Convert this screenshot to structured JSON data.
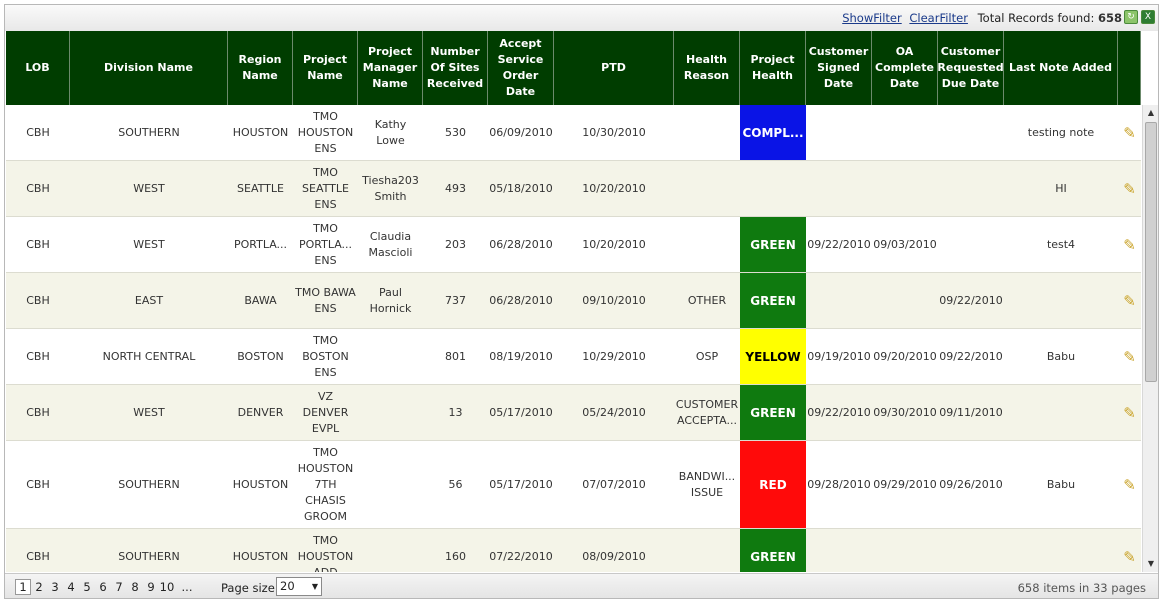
{
  "toolbar": {
    "show_filter": "ShowFilter",
    "clear_filter": "ClearFilter",
    "total_label": "Total Records found:",
    "total_count": "658",
    "refresh_icon": "refresh-icon",
    "excel_icon": "excel-export-icon"
  },
  "columns": [
    "LOB",
    "Division Name",
    "Region Name",
    "Project Name",
    "Project Manager Name",
    "Number Of Sites Received",
    "Accept Service Order Date",
    "PTD",
    "Health Reason",
    "Project Health",
    "Customer Signed Date",
    "OA Complete Date",
    "Customer Requested Due Date",
    "Last Note Added",
    ""
  ],
  "rows": [
    {
      "lob": "CBH",
      "division": "SOUTHERN",
      "region": "HOUSTON",
      "project": "TMO HOUSTON ENS",
      "manager": "Kathy Lowe",
      "sites": "530",
      "accept": "06/09/2010",
      "ptd": "10/30/2010",
      "reason": "",
      "health": "COMPL...",
      "health_color": "#0a14e6",
      "signed": "",
      "oa": "",
      "due": "",
      "note": "testing note"
    },
    {
      "lob": "CBH",
      "division": "WEST",
      "region": "SEATTLE",
      "project": "TMO SEATTLE ENS",
      "manager": "Tiesha203 Smith",
      "sites": "493",
      "accept": "05/18/2010",
      "ptd": "10/20/2010",
      "reason": "",
      "health": "",
      "health_color": "",
      "signed": "",
      "oa": "",
      "due": "",
      "note": "HI"
    },
    {
      "lob": "CBH",
      "division": "WEST",
      "region": "PORTLA...",
      "project": "TMO PORTLA... ENS",
      "manager": "Claudia Mascioli",
      "sites": "203",
      "accept": "06/28/2010",
      "ptd": "10/20/2010",
      "reason": "",
      "health": "GREEN",
      "health_color": "#0f7a0f",
      "signed": "09/22/2010",
      "oa": "09/03/2010",
      "due": "",
      "note": "test4"
    },
    {
      "lob": "CBH",
      "division": "EAST",
      "region": "BAWA",
      "project": "TMO BAWA ENS",
      "manager": "Paul Hornick",
      "sites": "737",
      "accept": "06/28/2010",
      "ptd": "09/10/2010",
      "reason": "OTHER",
      "health": "GREEN",
      "health_color": "#0f7a0f",
      "signed": "",
      "oa": "",
      "due": "09/22/2010",
      "note": ""
    },
    {
      "lob": "CBH",
      "division": "NORTH CENTRAL",
      "region": "BOSTON",
      "project": "TMO BOSTON ENS",
      "manager": "",
      "sites": "801",
      "accept": "08/19/2010",
      "ptd": "10/29/2010",
      "reason": "OSP",
      "health": "YELLOW",
      "health_color": "#ffff00",
      "signed": "09/19/2010",
      "oa": "09/20/2010",
      "due": "09/22/2010",
      "note": "Babu"
    },
    {
      "lob": "CBH",
      "division": "WEST",
      "region": "DENVER",
      "project": "VZ DENVER EVPL",
      "manager": "",
      "sites": "13",
      "accept": "05/17/2010",
      "ptd": "05/24/2010",
      "reason": "CUSTOMER ACCEPTA...",
      "health": "GREEN",
      "health_color": "#0f7a0f",
      "signed": "09/22/2010",
      "oa": "09/30/2010",
      "due": "09/11/2010",
      "note": ""
    },
    {
      "lob": "CBH",
      "division": "SOUTHERN",
      "region": "HOUSTON",
      "project": "TMO HOUSTON 7TH CHASIS GROOM",
      "manager": "",
      "sites": "56",
      "accept": "05/17/2010",
      "ptd": "07/07/2010",
      "reason": "BANDWI... ISSUE",
      "health": "RED",
      "health_color": "#ff0a0a",
      "signed": "09/28/2010",
      "oa": "09/29/2010",
      "due": "09/26/2010",
      "note": "Babu"
    },
    {
      "lob": "CBH",
      "division": "SOUTHERN",
      "region": "HOUSTON",
      "project": "TMO HOUSTON ADD",
      "manager": "",
      "sites": "160",
      "accept": "07/22/2010",
      "ptd": "08/09/2010",
      "reason": "",
      "health": "GREEN",
      "health_color": "#0f7a0f",
      "signed": "",
      "oa": "",
      "due": "",
      "note": ""
    }
  ],
  "edit_icon": "pencil-edit-icon",
  "pager": {
    "pages": [
      "1",
      "2",
      "3",
      "4",
      "5",
      "6",
      "7",
      "8",
      "9",
      "10",
      "..."
    ],
    "current": "1",
    "page_size_label": "Page size:",
    "page_size_value": "20",
    "summary": "658 items in 33 pages"
  }
}
